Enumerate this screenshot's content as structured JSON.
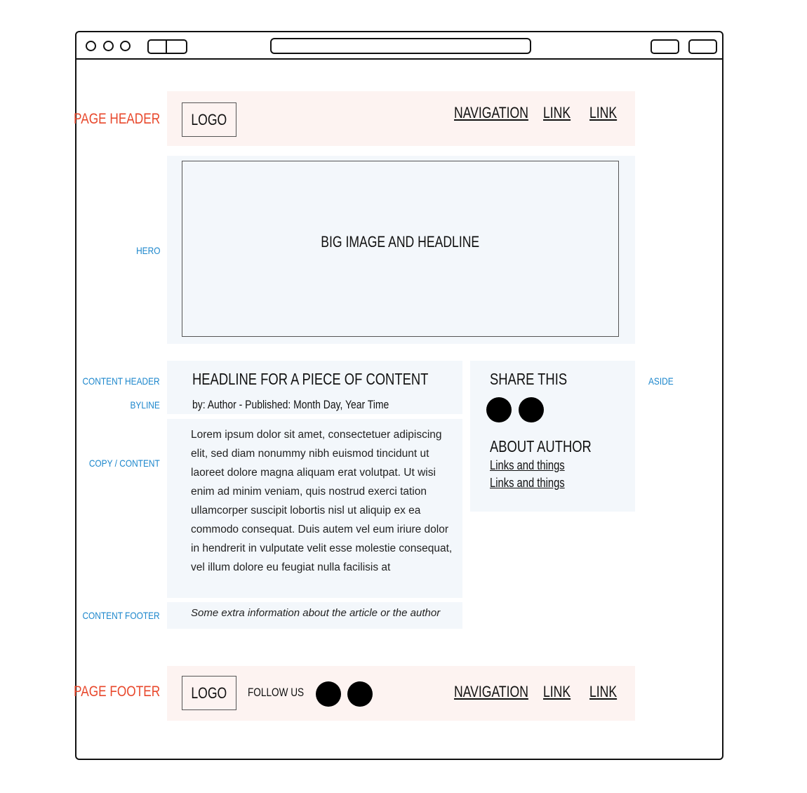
{
  "labels": {
    "page_header": "PAGE HEADER",
    "hero": "HERO",
    "content_header": "CONTENT HEADER",
    "byline": "BYLINE",
    "copy": "COPY / CONTENT",
    "content_footer": "CONTENT FOOTER",
    "aside": "ASIDE",
    "page_footer": "PAGE FOOTER"
  },
  "header": {
    "logo": "LOGO",
    "nav": [
      "NAVIGATION",
      "LINK",
      "LINK"
    ]
  },
  "hero": {
    "text": "BIG IMAGE AND HEADLINE"
  },
  "content": {
    "headline": "HEADLINE FOR A PIECE OF CONTENT",
    "byline": "by: Author - Published: Month Day, Year Time",
    "body": "Lorem ipsum dolor sit amet, consectetuer adipiscing elit, sed diam nonummy nibh euismod tincidunt ut laoreet dolore magna aliquam erat volutpat. Ut wisi enim ad minim veniam, quis nostrud exerci tation ullamcorper suscipit lobortis nisl ut aliquip ex ea commodo consequat. Duis autem vel eum iriure dolor in hendrerit in vulputate velit esse molestie consequat, vel illum dolore eu feugiat nulla facilisis at",
    "footer": "Some extra information about the article or the author"
  },
  "aside": {
    "share_title": "SHARE THIS",
    "about_title": "ABOUT AUTHOR",
    "links": [
      "Links and things",
      "Links and things"
    ]
  },
  "footer": {
    "logo": "LOGO",
    "follow": "FOLLOW US",
    "nav": [
      "NAVIGATION",
      "LINK",
      "LINK"
    ]
  },
  "colors": {
    "header_label": "#e8472b",
    "section_label": "#1b86cc",
    "pink_block": "#fdf3f1",
    "blue_block": "#f3f7fb"
  }
}
